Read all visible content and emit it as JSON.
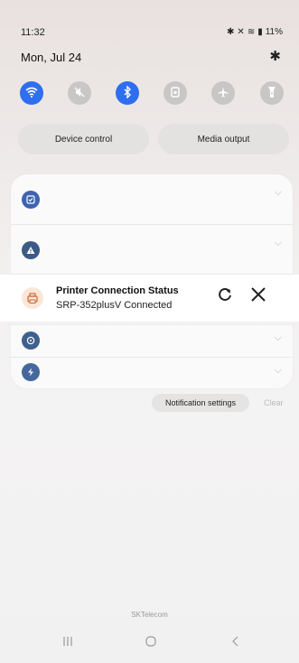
{
  "status_bar": {
    "time": "11:32",
    "icons": [
      "bluetooth-icon",
      "mute-icon",
      "wifi-icon",
      "signal-icon"
    ],
    "battery": "11%"
  },
  "header": {
    "date": "Mon, Jul 24",
    "settings_icon": "gear-icon"
  },
  "quick_settings": [
    {
      "icon": "wifi-icon",
      "state": "on"
    },
    {
      "icon": "mute-icon",
      "state": "off"
    },
    {
      "icon": "bluetooth-icon",
      "state": "on"
    },
    {
      "icon": "rotation-lock-icon",
      "state": "off"
    },
    {
      "icon": "airplane-icon",
      "state": "off"
    },
    {
      "icon": "flashlight-icon",
      "state": "off"
    }
  ],
  "pills": {
    "device_control": "Device control",
    "media_output": "Media output"
  },
  "notifications": {
    "printer": {
      "title": "Printer Connection Status",
      "subtitle": "SRP-352plusV Connected"
    },
    "settings_label": "Notification settings",
    "clear_label": "Clear"
  },
  "footer": {
    "carrier": "SKTelecom"
  },
  "colors": {
    "accent": "#2e6ef0",
    "app_icon_blue": "#3f5f9a"
  }
}
